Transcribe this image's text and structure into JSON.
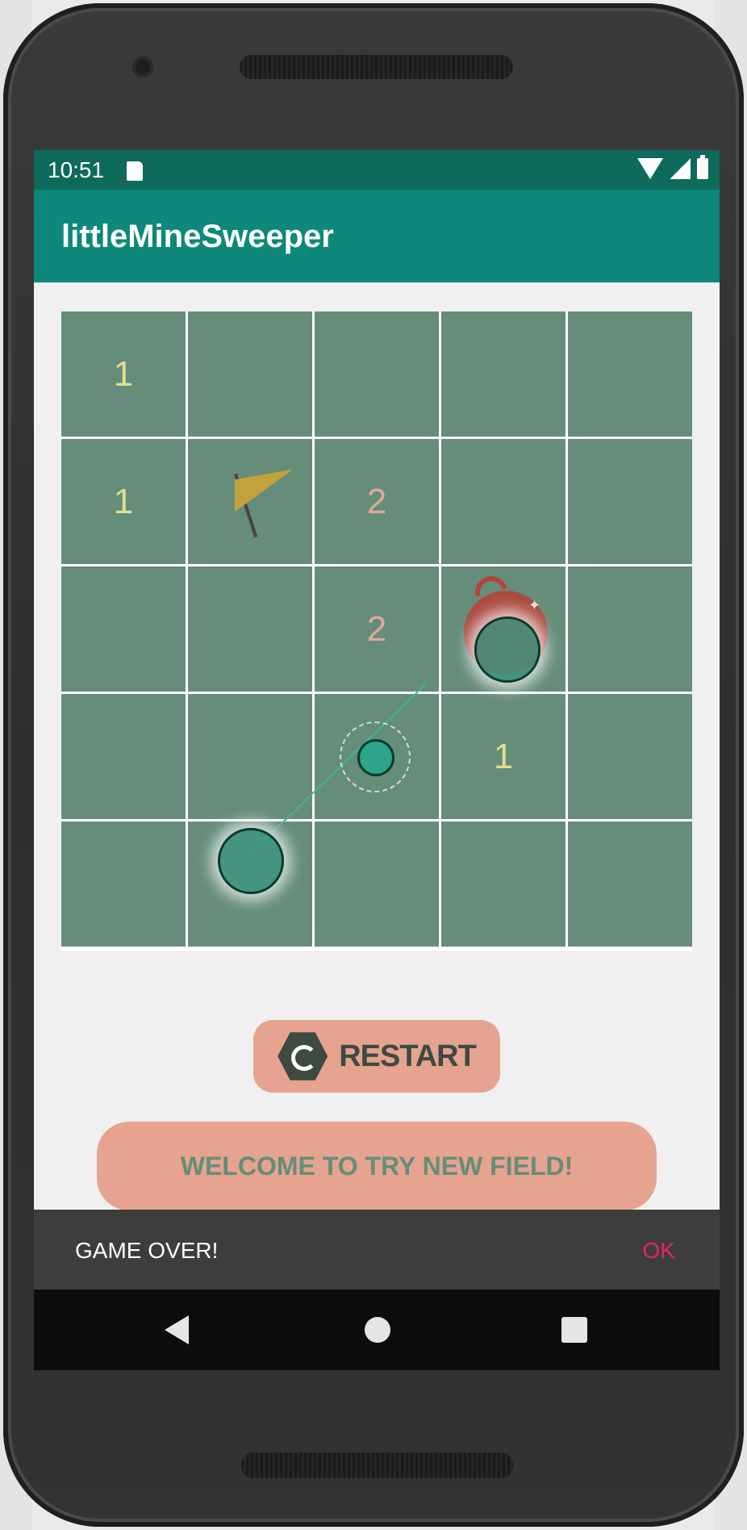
{
  "status_bar": {
    "time": "10:51",
    "icons": [
      "sd-card-icon",
      "wifi-icon",
      "signal-icon",
      "battery-icon"
    ]
  },
  "app_bar": {
    "title": "littleMineSweeper"
  },
  "board": {
    "rows": 5,
    "cols": 5,
    "cells": [
      [
        "1",
        "",
        "",
        "",
        ""
      ],
      [
        "1",
        "flag",
        "2",
        "",
        ""
      ],
      [
        "",
        "",
        "2",
        "bomb",
        ""
      ],
      [
        "",
        "",
        "",
        "1",
        ""
      ],
      [
        "",
        "",
        "",
        "",
        ""
      ]
    ]
  },
  "restart_button": {
    "label": "RESTART",
    "icon": "restart-hex-icon"
  },
  "welcome_banner": {
    "text": "WELCOME TO TRY NEW FIELD!"
  },
  "snackbar": {
    "message": "GAME OVER!",
    "action": "OK"
  },
  "colors": {
    "status_bar": "#0e6a5b",
    "app_bar": "#0e887a",
    "cell": "#658d79",
    "button": "#e6a38f",
    "snackbar_action": "#e2256c"
  }
}
